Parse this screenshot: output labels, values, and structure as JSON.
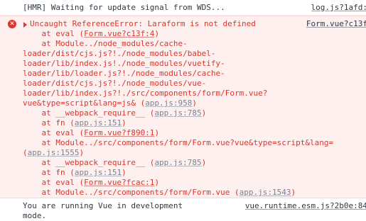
{
  "hmr": {
    "message": "[HMR] Waiting for update signal from WDS...",
    "source": "log.js?1afd:"
  },
  "error": {
    "icon": "x-circle-icon",
    "source": "Form.vue?c13f",
    "header": "Uncaught ReferenceError: Laraform is not defined",
    "lines": [
      {
        "pre": "    at eval (",
        "link": "Form.vue?c13f:4",
        "post": ")"
      },
      {
        "pre": "    at Module../node_modules/cache-",
        "link": "",
        "post": ""
      },
      {
        "pre": "loader/dist/cjs.js?!./node_modules/babel-",
        "link": "",
        "post": ""
      },
      {
        "pre": "loader/lib/index.js!./node_modules/vuetify-",
        "link": "",
        "post": ""
      },
      {
        "pre": "loader/lib/loader.js?!./node_modules/cache-",
        "link": "",
        "post": ""
      },
      {
        "pre": "loader/dist/cjs.js?!./node_modules/vue-",
        "link": "",
        "post": ""
      },
      {
        "pre": "loader/lib/index.js?!./src/components/form/Form.vue?",
        "link": "",
        "post": ""
      },
      {
        "pre": "vue&type=script&lang=js& (",
        "link": "app.js:958",
        "post": ")"
      },
      {
        "pre": "    at __webpack_require__ (",
        "link": "app.js:785",
        "post": ")"
      },
      {
        "pre": "    at fn (",
        "link": "app.js:151",
        "post": ")"
      },
      {
        "pre": "    at eval (",
        "link": "Form.vue?f890:1",
        "post": ")"
      },
      {
        "pre": "    at Module../src/components/form/Form.vue?vue&type=script&lang=",
        "link": "",
        "post": ""
      },
      {
        "pre": "(",
        "link": "app.js:1555",
        "post": ")"
      },
      {
        "pre": "    at __webpack_require__ (",
        "link": "app.js:785",
        "post": ")"
      },
      {
        "pre": "    at fn (",
        "link": "app.js:151",
        "post": ")"
      },
      {
        "pre": "    at eval (",
        "link": "Form.vue?fcac:1",
        "post": ")"
      },
      {
        "pre": "    at Module../src/components/form/Form.vue (",
        "link": "app.js:1543",
        "post": ")"
      }
    ]
  },
  "vue": {
    "message": "You are running Vue in development\nmode.",
    "source": "vue.runtime.esm.js?2b0e:84"
  },
  "colors": {
    "error_text": "#e0332a",
    "error_bg": "#fff0f0",
    "link_gray": "#7b8290"
  }
}
